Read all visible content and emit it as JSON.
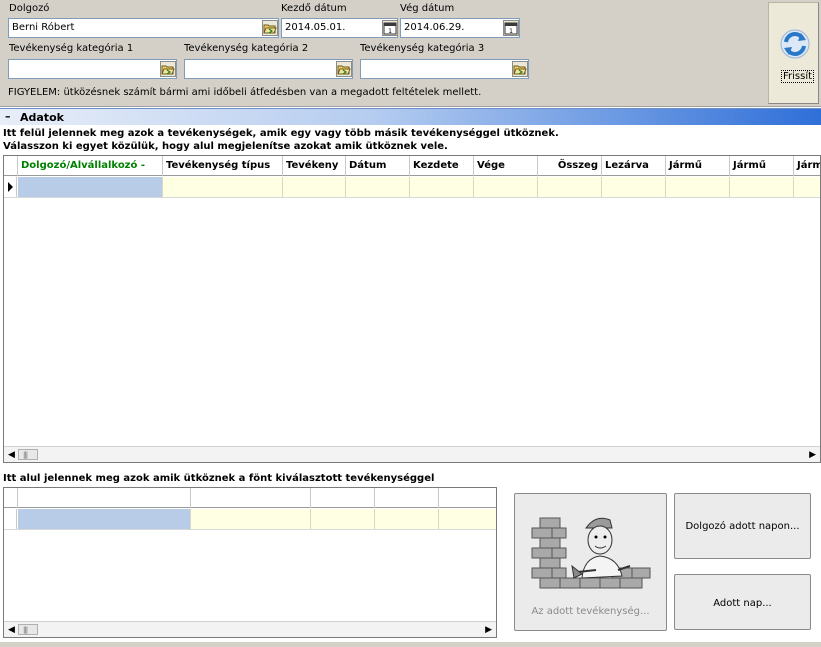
{
  "filters": {
    "employee": {
      "label": "Dolgozó",
      "value": "Berni Róbert"
    },
    "start_date": {
      "label": "Kezdő dátum",
      "value": "2014.05.01."
    },
    "end_date": {
      "label": "Vég dátum",
      "value": "2014.06.29."
    },
    "category1": {
      "label": "Tevékenység kategória 1",
      "value": ""
    },
    "category2": {
      "label": "Tevékenység kategória 2",
      "value": ""
    },
    "category3": {
      "label": "Tevékenység kategória 3",
      "value": ""
    },
    "warning": "FIGYELEM: ütközésnek számít bármi ami időbeli átfedésben van a megadott feltételek mellett."
  },
  "refresh": {
    "label": "Frissít",
    "icon": "refresh-icon"
  },
  "section": {
    "collapse_symbol": "–",
    "title": "Adatok"
  },
  "top_info": {
    "line1": "Itt felül jelennek meg azok a tevékenységek, amik egy vagy több másik tevékenységgel ütköznek.",
    "line2": "Válasszon ki egyet közülük, hogy alul megjelenítse azokat amik ütköznek vele."
  },
  "top_grid": {
    "columns": [
      "Dolgozó/Alvállalkozó",
      "Tevékenység típus",
      "Tevékeny",
      "Dátum",
      "Kezdete",
      "Vége",
      "Összeg",
      "Lezárva",
      "Jármű",
      "Jármű",
      "Járm"
    ],
    "first_column_color": "#008000",
    "sort_indicator": "-"
  },
  "bottom_info": "Itt alul jelennek meg azok amik ütköznek a fönt kiválasztott tevékenységgel",
  "buttons": {
    "activity": "Az adott tevékenység...",
    "employee_day": "Dolgozó adott napon...",
    "day": "Adott nap..."
  },
  "colors": {
    "panel_bg": "#d4d0c8",
    "grid_row_bg": "#ffffe4",
    "selected_cell": "#b8cce8",
    "header_gradient_end": "#2f6fd8"
  }
}
